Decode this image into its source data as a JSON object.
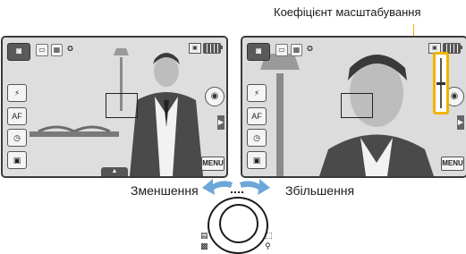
{
  "callout": {
    "label": "Коефіцієнт масштабування"
  },
  "screens": [
    {
      "mode_icon": "camera-mode-icon",
      "flash_label": "⚡",
      "af_label": "AF",
      "timer_label": "◷",
      "stab_label": "▣",
      "menu_label": "MENU",
      "scene_icon": "smart-scene-icon",
      "arrow_label": "▶",
      "bottom_tab_label": "▲"
    },
    {
      "mode_icon": "camera-mode-icon",
      "flash_label": "⚡",
      "af_label": "AF",
      "timer_label": "◷",
      "stab_label": "▣",
      "menu_label": "MENU",
      "scene_icon": "smart-scene-icon",
      "arrow_label": "▶"
    }
  ],
  "zoom": {
    "decrease_label": "Зменшення",
    "increase_label": "Збільшення",
    "level": 0.5
  },
  "colors": {
    "accent": "#f0b400",
    "arrow_blue": "#6da7d8"
  }
}
